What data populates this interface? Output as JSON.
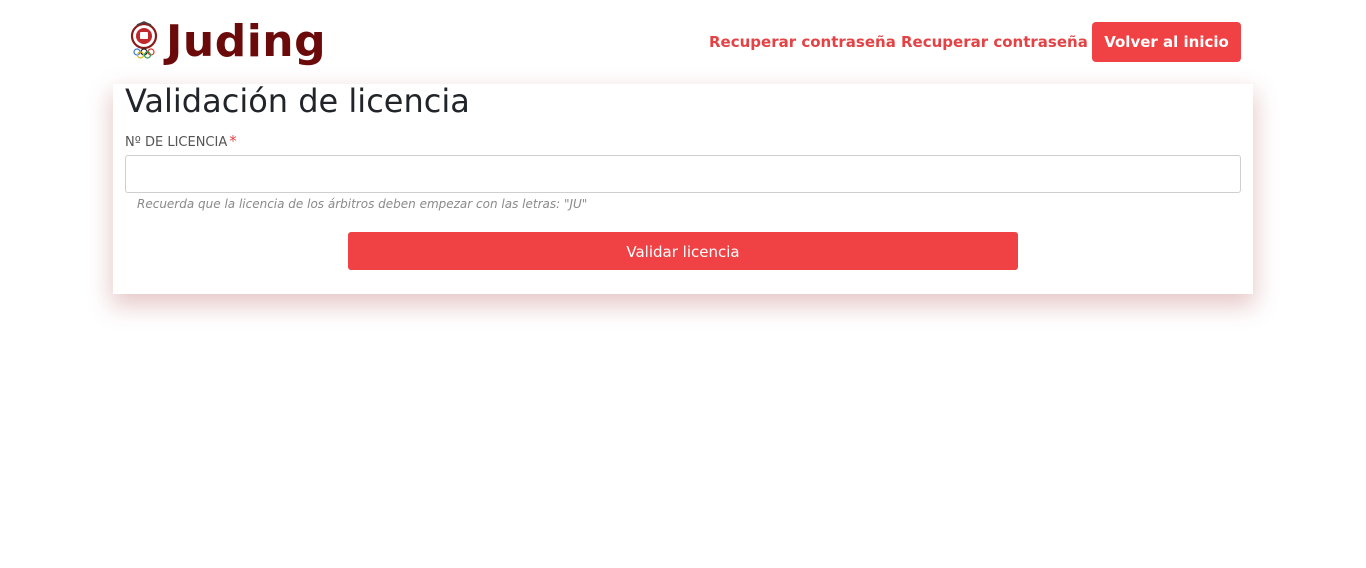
{
  "brand": {
    "name": "Juding",
    "emblem_icon": "judo-federation-emblem-icon",
    "color": "#6b0a0a"
  },
  "nav": {
    "links": [
      {
        "label": "Recuperar contraseña"
      },
      {
        "label": "Recuperar contraseña"
      }
    ],
    "home_button_label": "Volver al inicio"
  },
  "form": {
    "title": "Validación de licencia",
    "license_label": "Nº DE LICENCIA",
    "required_mark": "*",
    "license_value": "",
    "license_placeholder": "",
    "help_text": "Recuerda que la licencia de los árbitros deben empezar con las letras: \"JU\"",
    "submit_label": "Validar licencia"
  },
  "colors": {
    "accent": "#f04144",
    "link": "#e34345",
    "brand_text": "#6b0a0a"
  }
}
